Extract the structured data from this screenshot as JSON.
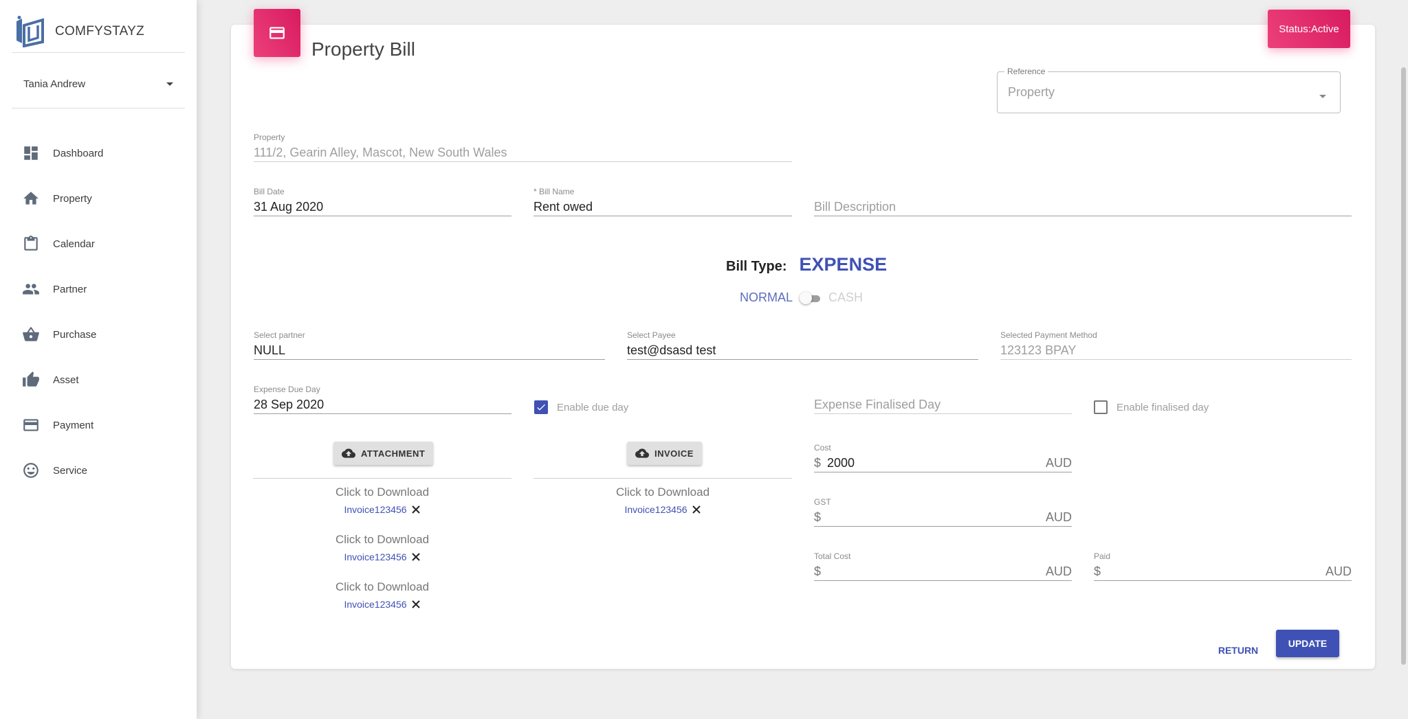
{
  "brand": {
    "name": "COMFYSTAYZ"
  },
  "user": {
    "name": "Tania Andrew"
  },
  "nav": [
    {
      "label": "Dashboard",
      "icon": "dashboard-icon"
    },
    {
      "label": "Property",
      "icon": "home-icon"
    },
    {
      "label": "Calendar",
      "icon": "clipboard-icon"
    },
    {
      "label": "Partner",
      "icon": "people-icon"
    },
    {
      "label": "Purchase",
      "icon": "basket-icon"
    },
    {
      "label": "Asset",
      "icon": "thumb-up-icon"
    },
    {
      "label": "Payment",
      "icon": "credit-card-icon"
    },
    {
      "label": "Service",
      "icon": "smiley-icon"
    }
  ],
  "page": {
    "title": "Property Bill",
    "status": "Status:Active"
  },
  "reference": {
    "label": "Reference",
    "value": "Property"
  },
  "property": {
    "label": "Property",
    "value": "111/2, Gearin Alley, Mascot, New South Wales"
  },
  "bill_date": {
    "label": "Bill Date",
    "value": "31 Aug 2020"
  },
  "bill_name": {
    "label": "* Bill Name",
    "value": "Rent owed"
  },
  "bill_description": {
    "placeholder": "Bill Description"
  },
  "bill_type": {
    "label": "Bill Type:",
    "value": "EXPENSE",
    "normal": "NORMAL",
    "cash": "CASH"
  },
  "partner": {
    "label": "Select partner",
    "value": "NULL"
  },
  "payee": {
    "label": "Select Payee",
    "value": "test@dsasd test"
  },
  "payment_method": {
    "label": "Selected Payment Method",
    "value": "123123 BPAY"
  },
  "expense_due_day": {
    "label": "Expense Due Day",
    "value": "28 Sep 2020"
  },
  "enable_due_day": {
    "label": "Enable due day",
    "checked": true
  },
  "expense_finalised_day": {
    "placeholder": "Expense Finalised Day"
  },
  "enable_finalised_day": {
    "label": "Enable finalised day",
    "checked": false
  },
  "attachment": {
    "button": "ATTACHMENT",
    "download_text": "Click to Download",
    "files": [
      "Invoice123456",
      "Invoice123456",
      "Invoice123456"
    ]
  },
  "invoice": {
    "button": "INVOICE",
    "download_text": "Click to Download",
    "files": [
      "Invoice123456"
    ]
  },
  "cost": {
    "label": "Cost",
    "currency": "$",
    "value": "2000",
    "unit": "AUD"
  },
  "gst": {
    "label": "GST",
    "currency": "$",
    "value": "",
    "unit": "AUD"
  },
  "total_cost": {
    "label": "Total Cost",
    "currency": "$",
    "value": "",
    "unit": "AUD"
  },
  "paid": {
    "label": "Paid",
    "currency": "$",
    "value": "",
    "unit": "AUD"
  },
  "actions": {
    "return": "RETURN",
    "update": "UPDATE"
  },
  "colors": {
    "primary": "#3f51b5",
    "accent": "#e91e63"
  }
}
